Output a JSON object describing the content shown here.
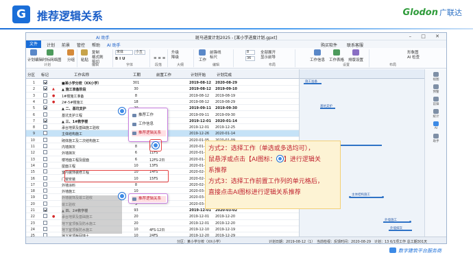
{
  "slide": {
    "logo_glyph": "G",
    "title": "推荐逻辑关系",
    "brand": {
      "latin": "Glodon",
      "cn": "广联达"
    },
    "footer": "数字建筑平台服务商"
  },
  "window": {
    "doc_title": "斑马进度计划2025 - [某小学进度计划.gpxt]",
    "ai_assistant": "AI 助手",
    "controls": "– □ ✕"
  },
  "tabs": [
    "文件",
    "计划",
    "前景",
    "管控",
    "帮助",
    "AI 助手"
  ],
  "tabs_right": [
    "购买软件",
    "联系客服"
  ],
  "ribbon": {
    "groups": [
      "计划",
      "编辑",
      "字体",
      "段落",
      "大纲",
      "编辑",
      "布局",
      "设置",
      "布局"
    ],
    "buttons": [
      "计划编辑",
      "时标网络图",
      "分组",
      "粘贴",
      "复制",
      "格式刷",
      "剪切",
      "删除",
      "升级",
      "降级",
      "工作",
      "前锋线",
      "标尺",
      "全部展开",
      "显示前导",
      "工作信息",
      "工作表格",
      "排版设置",
      "形象图",
      "AI 检查"
    ],
    "font_name": "宋体",
    "font_size": "小五",
    "zoom_a": "8",
    "zoom_b": "36"
  },
  "grid": {
    "headers": [
      "分区",
      "标记",
      "工作名称",
      "工期",
      "前置工作",
      "计划开始",
      "计划完成"
    ],
    "rows": [
      {
        "no": "1",
        "chk": true,
        "mk": "",
        "name": "■某小学分校（XX小学）",
        "dur": "301",
        "pre": "",
        "start": "2019-08-12",
        "end": "2020-08-29",
        "sum": true
      },
      {
        "no": "2",
        "chk": true,
        "mk": "▲",
        "name": "▲ 施工准备阶段",
        "dur": "30",
        "pre": "",
        "start": "2019-08-12",
        "end": "2019-09-10",
        "sum": true
      },
      {
        "no": "3",
        "chk": false,
        "mk": "●",
        "name": "1#楼施工准备",
        "dur": "8",
        "pre": "",
        "start": "2019-08-12",
        "end": "2019-08-19",
        "sum": false
      },
      {
        "no": "4",
        "chk": false,
        "mk": "●",
        "name": "2#-5#楼施工",
        "dur": "18",
        "pre": "",
        "start": "2019-08-12",
        "end": "2019-08-29",
        "sum": false
      },
      {
        "no": "5",
        "chk": true,
        "mk": "",
        "name": "▲ 二、基坑支护",
        "dur": "20",
        "pre": "",
        "start": "2019-09-11",
        "end": "2019-09-30",
        "sum": true
      },
      {
        "no": "6",
        "chk": false,
        "mk": "",
        "name": "基坑支护工程",
        "dur": "20",
        "pre": "",
        "start": "2019-09-11",
        "end": "2019-09-30",
        "sum": false
      },
      {
        "no": "7",
        "chk": true,
        "mk": "",
        "name": "▲ 三、1#教学楼",
        "dur": "45",
        "pre": "",
        "start": "2019-12-01",
        "end": "2020-01-14",
        "sum": true
      },
      {
        "no": "8",
        "chk": false,
        "mk": "",
        "name": "承台地梁及基础施工验收",
        "dur": "25",
        "pre": "",
        "start": "2019-12-01",
        "end": "2019-12-25",
        "sum": false
      },
      {
        "no": "9",
        "chk": false,
        "mk": "",
        "name": "主体结构施工",
        "dur": "20",
        "pre": "",
        "start": "2019-12-26",
        "end": "2020-01-14",
        "sum": false
      },
      {
        "no": "10",
        "chk": false,
        "mk": "",
        "name": "砌体施工及二次结构施工",
        "dur": "5",
        "pre": "9FS-2日",
        "start": "2020-01-05",
        "end": "2020-01-09",
        "sum": false
      },
      {
        "no": "11",
        "chk": false,
        "mk": "",
        "name": "内墙抹灰",
        "dur": "8",
        "pre": "10FS",
        "start": "2020-01-10",
        "end": "2020-01-17",
        "sum": false
      },
      {
        "no": "12",
        "chk": false,
        "mk": "",
        "name": "外墙抹灰",
        "dur": "6",
        "pre": "11FS",
        "start": "2020-01-18",
        "end": "2020-01-23",
        "sum": false
      },
      {
        "no": "13",
        "chk": false,
        "mk": "",
        "name": "楼地面工程及屋面",
        "dur": "6",
        "pre": "12FS-2日",
        "start": "2020-01-22",
        "end": "2020-01-27",
        "sum": false
      },
      {
        "no": "14",
        "chk": false,
        "mk": "",
        "name": "屋面工程",
        "dur": "10",
        "pre": "13FS",
        "start": "2020-01-28",
        "end": "2020-02-06",
        "sum": false
      },
      {
        "no": "15",
        "chk": false,
        "mk": "",
        "name": "室内装饰装修工程",
        "dur": "10",
        "pre": "14FS",
        "start": "2020-02-07",
        "end": "2020-02-16",
        "sum": false
      },
      {
        "no": "16",
        "chk": false,
        "mk": "",
        "name": "门窗安装",
        "dur": "10",
        "pre": "15FS",
        "start": "2020-02-17",
        "end": "2020-02-26",
        "sum": false
      },
      {
        "no": "17",
        "chk": false,
        "mk": "",
        "name": "外墙涂料",
        "dur": "8",
        "pre": "",
        "start": "2020-02-27",
        "end": "2020-03-05",
        "sum": false
      },
      {
        "no": "18",
        "chk": false,
        "mk": "",
        "name": "外墙施工",
        "dur": "10",
        "pre": "",
        "start": "2020-03-06",
        "end": "2020-03-15",
        "sum": false
      },
      {
        "no": "19",
        "chk": false,
        "mk": "",
        "name": "外墙装饰及竣工验收",
        "dur": "10",
        "pre": "",
        "start": "2020-03-16",
        "end": "2020-03-25",
        "sum": false
      },
      {
        "no": "20",
        "chk": false,
        "mk": "",
        "name": "竣工验收",
        "dur": "3",
        "pre": "",
        "start": "2020-03-26",
        "end": "2020-03-28",
        "sum": false
      },
      {
        "no": "21",
        "chk": true,
        "mk": "",
        "name": "▲ 四、2#教学楼",
        "dur": "93",
        "pre": "",
        "start": "2019-12-01",
        "end": "2020-03-02",
        "sum": true
      },
      {
        "no": "22",
        "chk": false,
        "mk": "●",
        "name": "承台地梁及基础施工",
        "dur": "20",
        "pre": "",
        "start": "2019-12-01",
        "end": "2019-12-20",
        "sum": false
      },
      {
        "no": "23",
        "chk": false,
        "mk": "",
        "name": "地下室顶板及防水施工",
        "dur": "20",
        "pre": "",
        "start": "2019-12-01",
        "end": "2019-12-20",
        "sum": false
      },
      {
        "no": "24",
        "chk": false,
        "mk": "",
        "name": "地下室顶板防水施工",
        "dur": "10",
        "pre": "4FS-12日",
        "start": "2019-12-10",
        "end": "2019-12-19",
        "sum": false
      },
      {
        "no": "25",
        "chk": false,
        "mk": "",
        "name": "地下室顶板回填土",
        "dur": "10",
        "pre": "24FS",
        "start": "2019-12-20",
        "end": "2019-12-29",
        "sum": false
      },
      {
        "no": "26",
        "chk": false,
        "mk": "",
        "name": "地下室防水施工",
        "dur": "10",
        "pre": "25FS",
        "start": "2019-12-30",
        "end": "2020-01-08",
        "sum": false
      }
    ]
  },
  "popups": {
    "top": [
      "推荐工作",
      "工作信息",
      "推荐逻辑关系"
    ],
    "bottom": [
      "推荐逻辑关系"
    ]
  },
  "gantt_labels": [
    "施工准备",
    "基坑支护",
    "主体结构施工",
    "外墙施工",
    "外墙抹灰"
  ],
  "side_pane": [
    "视图",
    "预警",
    "前锋",
    "统计",
    "AI",
    "助手"
  ],
  "tip": {
    "line1": "方式2：选择工作（单选或多选均可），",
    "line2a": "鼠悬浮或点击【AI图标：",
    "line2b": "】进行逻辑关",
    "line3": "系推荐",
    "line4": "方式3：选择工作前置工作列的单元格后，",
    "line5": "直接点击AI图标进行逻辑关系推荐"
  },
  "status": {
    "section": "分区：某小学分校（XX小学）",
    "datetime": "计划日期：2019-08-12（1）",
    "right": "当前检视：反馈时间：2020-08-29",
    "count": "计划：13  6/1项工作 总工期301天"
  }
}
